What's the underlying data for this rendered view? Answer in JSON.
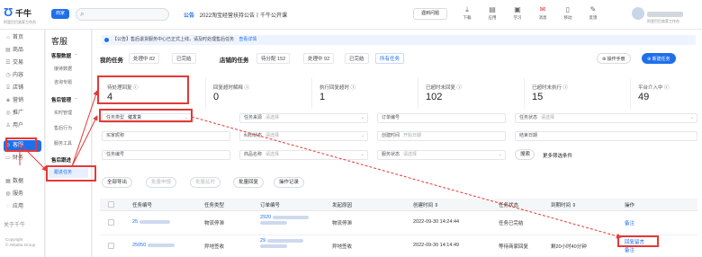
{
  "topbar": {
    "logo_mark": "Ʊ",
    "logo_name": "千牛",
    "logo_sub": "阿里巴巴卖家工作台",
    "store_label": "商家",
    "search_icon": "search-icon",
    "announce_tag": "公告",
    "announce_text": "2022淘宝经营扶持公告丨千牛公开课",
    "help_label": "遇到问题",
    "tools": [
      {
        "icon": "download-icon",
        "glyph": "⤓",
        "label": "下载"
      },
      {
        "icon": "app-icon",
        "glyph": "▤",
        "label": "应用"
      },
      {
        "icon": "learn-icon",
        "glyph": "▣",
        "label": "学习"
      },
      {
        "icon": "message-icon",
        "glyph": "✉",
        "label": "消息"
      },
      {
        "icon": "mobile-icon",
        "glyph": "▯",
        "label": "移动"
      },
      {
        "icon": "feedback-icon",
        "glyph": "✎",
        "label": "反馈"
      }
    ],
    "user_sub": "阿里巴巴卖家工作台"
  },
  "icon_nav": [
    {
      "glyph": "⌂",
      "icon": "home-icon",
      "label": "首页"
    },
    {
      "glyph": "▤",
      "icon": "product-icon",
      "label": "商品"
    },
    {
      "glyph": "☰",
      "icon": "order-icon",
      "label": "交易"
    },
    {
      "glyph": "◷",
      "icon": "content-icon",
      "label": "内容"
    },
    {
      "glyph": "⌸",
      "icon": "store-icon",
      "label": "店铺"
    },
    {
      "glyph": "◈",
      "icon": "marketing-icon",
      "label": "营销"
    },
    {
      "glyph": "◎",
      "icon": "promotion-icon",
      "label": "推广"
    },
    {
      "glyph": "♙",
      "icon": "user-icon",
      "label": "用户"
    },
    {
      "glyph": "☺",
      "icon": "service-icon",
      "label": "客服"
    },
    {
      "glyph": "▭",
      "icon": "finance-icon",
      "label": "财务"
    },
    {
      "glyph": "▦",
      "icon": "data-icon",
      "label": "数据"
    },
    {
      "glyph": "◍",
      "icon": "service-market-icon",
      "label": "服务"
    },
    {
      "glyph": "◌",
      "icon": "apps-icon",
      "label": "应用"
    }
  ],
  "about_label": "关于千牛",
  "copyright_lines": [
    "Copyright",
    "© Alibaba Group"
  ],
  "sub_nav": {
    "title": "客服",
    "groups": [
      {
        "label": "客服数据",
        "items": [
          "接待数据",
          "咨询专题"
        ]
      },
      {
        "label": "售后管理",
        "items": [
          "实时管理",
          "售后行为",
          "服务工具"
        ]
      },
      {
        "label": "售后跟进",
        "items": [
          "跟进任务"
        ]
      }
    ]
  },
  "main": {
    "notice_text": "【公告】售后退货服务中心已正式上线，请及时处理售后任务",
    "notice_link": "查看详情",
    "row1": {
      "label_mine": "我的任务",
      "chips_mine": [
        "处理中 82",
        "已完结"
      ],
      "label_store": "店铺的任务",
      "chips_store": [
        "待分配 152",
        "处理中 92",
        "已完结"
      ],
      "link_all": "所有任务",
      "btn_manual": "⊛ 操作手册",
      "btn_new": "⊕ 新建任务"
    },
    "stats": [
      {
        "label": "待处理回复 ⓘ",
        "value": "4"
      },
      {
        "label": "回复超时解释 ⓘ",
        "value": "0"
      },
      {
        "label": "执行回复超时 ⓘ",
        "value": "1"
      },
      {
        "label": "已超时未回复 ⓘ",
        "value": "102"
      },
      {
        "label": "已超时未执行 ⓘ",
        "value": "15"
      },
      {
        "label": "平台介入中 ⓘ",
        "value": "49"
      }
    ],
    "filters": {
      "task_type_label": "任务类型",
      "task_type_value": "催发货",
      "task_source_label": "任务来源",
      "task_source_value": "请选择",
      "order_no_label": "订单编号",
      "order_no_value": "",
      "task_status_label": "任务状态",
      "task_status_value": "请选择",
      "buyer_label": "买家昵称",
      "buyer_value": "",
      "case_label": "纠纷状态",
      "case_value": "请选择",
      "creator_label": "创建时间",
      "creator_value": "开始日期",
      "end_label": "结束日期",
      "end_value": "",
      "task_no_label": "任务编号",
      "task_no_value": "",
      "goods_label": "商品名称",
      "goods_value": "请选择",
      "deadline_label": "服务状态",
      "deadline_value": "请选择",
      "search_btn": "搜索",
      "more_link": "更多筛选条件"
    },
    "actions": [
      "全部导出",
      "批量申报",
      "批量延时",
      "批量回复",
      "操作记录"
    ],
    "table": {
      "headers": [
        "任务编号",
        "任务类型",
        "订单编号",
        "发起原因",
        "创建时间 ⇕",
        "任务状态",
        "到期时间 ⇕",
        "操作"
      ],
      "rows": [
        {
          "id": "25",
          "type": "物流停滞",
          "order": "2920",
          "reason": "物流停滞",
          "created": "2022-09-30 14:24:44",
          "status": "任务已完结",
          "due": "",
          "action": "备注"
        },
        {
          "id": "25050",
          "type": "异地签收",
          "order": "29",
          "reason": "异地签收",
          "created": "2022-09-30 14:14:49",
          "status": "等待商家回复",
          "due": "剩20小时40分钟",
          "action": "回复留言",
          "action2": "备注"
        }
      ]
    }
  }
}
